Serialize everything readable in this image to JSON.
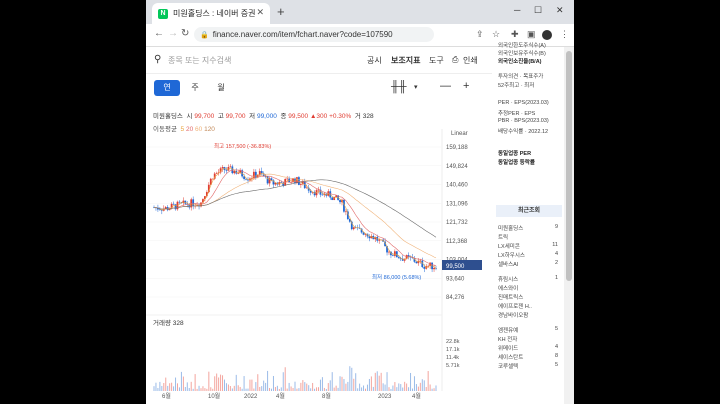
{
  "browser": {
    "tab_title": "미원홀딩스 : 네이버 증권",
    "url": "finance.naver.com/item/fchart.naver?code=107590"
  },
  "toolbar": {
    "search_placeholder": "종목 또는 지수검색",
    "disclosure": "공시",
    "indicator": "보조지표",
    "tools": "도구",
    "print": "인쇄"
  },
  "periods": {
    "year": "연",
    "week": "주",
    "month": "월"
  },
  "stock_info": {
    "name": "미원홀딩스",
    "open_label": "시",
    "open": "99,700",
    "high_label": "고",
    "high": "99,700",
    "low_label": "저",
    "low": "99,000",
    "close_label": "종",
    "close": "99,500",
    "change": "▲300",
    "change_pct": "+0.30%",
    "volume_label": "거",
    "volume": "328"
  },
  "ma": {
    "label": "이동평균",
    "p5": "5",
    "p20": "20",
    "p60": "60",
    "p120": "120"
  },
  "chart": {
    "scale": "Linear",
    "max_label": "최고 157,500 (-36.83%)",
    "min_label": "최저 86,000 (5.68%)",
    "current_price": "99,500",
    "volume_title": "거래량 328",
    "colors": {
      "up": "#e03c31",
      "down": "#1f68d6",
      "ma5": "#e8a33d",
      "ma20": "#e26a6a",
      "ma60": "#f0b37a",
      "ma120": "#6c6c6c"
    }
  },
  "chart_data": {
    "type": "line",
    "title": "",
    "y_ticks": [
      "159,188",
      "149,824",
      "140,460",
      "131,096",
      "121,732",
      "112,368",
      "103,004",
      "93,640",
      "84,276"
    ],
    "volume_ticks": [
      "22.8k",
      "17.1k",
      "11.4k",
      "5.71k"
    ],
    "x_ticks": [
      "6월",
      "10월",
      "2022",
      "4월",
      "8월",
      "2023",
      "4월"
    ],
    "ylim": [
      84276,
      159188
    ],
    "series": [
      {
        "name": "종가",
        "x": [
          "2021-05",
          "2021-06",
          "2021-07",
          "2021-08",
          "2021-09",
          "2021-10",
          "2021-11",
          "2021-12",
          "2022-01",
          "2022-02",
          "2022-03",
          "2022-04",
          "2022-05",
          "2022-06",
          "2022-07",
          "2022-08",
          "2022-09",
          "2022-10",
          "2022-11",
          "2022-12",
          "2023-01",
          "2023-02",
          "2023-03",
          "2023-04",
          "2023-05"
        ],
        "values": [
          129000,
          128500,
          130000,
          131000,
          131500,
          145000,
          148000,
          147000,
          144000,
          146000,
          141000,
          141500,
          143000,
          139000,
          136000,
          135000,
          131000,
          118000,
          116500,
          113000,
          107000,
          104000,
          103000,
          100000,
          99500
        ]
      }
    ]
  },
  "sidebar": {
    "top_items": [
      "외국인한도주식수(A)",
      "외국인보유주식수(B)",
      "외국인소진율(B/A)"
    ],
    "invest": [
      "투자의견 · 목표주가",
      "52주최고 · 최저"
    ],
    "per": [
      "PER · EPS(2023.03)",
      "추정PER · EPS",
      "PBR · BPS(2023.03)",
      "배당수익률 · 2022.12"
    ],
    "sector": [
      "동일업종 PER",
      "동일업종 등락률"
    ],
    "recent_title": "최근조회",
    "recent": [
      {
        "name": "미원홀딩스",
        "count": "9"
      },
      {
        "name": "트릭",
        "count": ""
      },
      {
        "name": "LX세미콘",
        "count": "11"
      },
      {
        "name": "LX하우시스",
        "count": "4"
      },
      {
        "name": "셀바스AI",
        "count": "2"
      },
      {
        "name": "휴림시스",
        "count": "1"
      },
      {
        "name": "에스와이",
        "count": ""
      },
      {
        "name": "진매트릭스",
        "count": ""
      },
      {
        "name": "에이프로젠 H..",
        "count": ""
      },
      {
        "name": "경남바이오팜",
        "count": ""
      },
      {
        "name": "엠젠유예",
        "count": "5"
      },
      {
        "name": "KH 전자",
        "count": ""
      },
      {
        "name": "위메이드",
        "count": "4"
      },
      {
        "name": "셰이스탄트",
        "count": "8"
      },
      {
        "name": "코루셀텍",
        "count": "5"
      }
    ]
  }
}
